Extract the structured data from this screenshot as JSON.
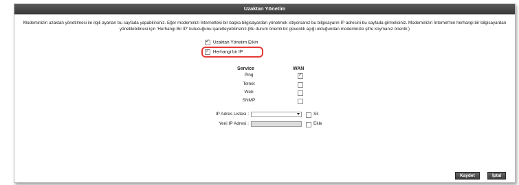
{
  "window": {
    "title": "Uzaktan Yönetim"
  },
  "description": "Modeminizin uzaktan yönetilmesi ile ilgili ayarları bu sayfada yapabilirsiniz. Eğer modeminizi İnternetteki bir başka bilgisayardan yönetmek istiyorsanız bu bilgisayarın IP adresini bu sayfada girmelisiniz. Modeminizin İnternet'ten herhangi bir bilgisayardan yönetilebilmesi için 'Herhangi Bir IP' kutucuğunu işaretleyebilirsiniz.(Bu durum önemli bir güvenlik açığı olduğundan modeminize şifre koymanız önerilir.)",
  "options": {
    "remote_enable": {
      "label": "Uzaktan Yönetim Etkin",
      "checked": true
    },
    "any_ip": {
      "label": "Herhangi bir IP",
      "checked": true
    }
  },
  "services": {
    "header_service": "Service",
    "header_wan": "WAN",
    "rows": [
      {
        "name": "Ping",
        "wan": true
      },
      {
        "name": "Telnet",
        "wan": false
      },
      {
        "name": "Web",
        "wan": false
      },
      {
        "name": "SNMP",
        "wan": false
      }
    ]
  },
  "ip_list": {
    "label": "IP Adres Listesi :",
    "value": "",
    "delete_label": "Sil"
  },
  "new_ip": {
    "label": "Yeni IP Adresi :",
    "value": "",
    "add_label": "Ekle"
  },
  "buttons": {
    "save": "Kaydet",
    "cancel": "İptal"
  },
  "colors": {
    "titlebar": "#4a4a4a",
    "highlight": "#e53935"
  }
}
